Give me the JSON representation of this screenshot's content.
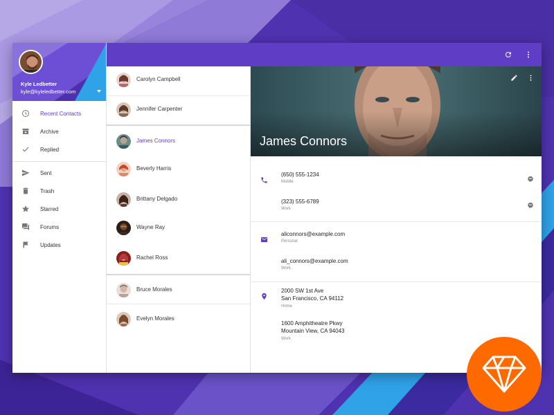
{
  "user": {
    "name": "Kyle Ledbetter",
    "email": "kyle@kyleledbetter.com"
  },
  "nav": {
    "items": [
      {
        "label": "Recent Contacts",
        "icon": "clock-icon",
        "active": true
      },
      {
        "label": "Archive",
        "icon": "archive-icon"
      },
      {
        "label": "Replied",
        "icon": "check-icon"
      },
      {
        "label": "Sent",
        "icon": "send-icon"
      },
      {
        "label": "Trash",
        "icon": "trash-icon"
      },
      {
        "label": "Starred",
        "icon": "star-icon"
      },
      {
        "label": "Forums",
        "icon": "forum-icon"
      },
      {
        "label": "Updates",
        "icon": "flag-icon"
      }
    ]
  },
  "toolbar": {
    "refresh_icon": "refresh-icon",
    "more_icon": "more-vert-icon"
  },
  "contacts": [
    {
      "name": "Carolyn Campbell",
      "avatar_color": "#c78f8a"
    },
    {
      "name": "Jennifer Carpenter",
      "avatar_color": "#8b6a55"
    },
    {
      "name": "James Connors",
      "avatar_color": "#6a8d8a",
      "active": true
    },
    {
      "name": "Beverly Harris",
      "avatar_color": "#d9896c"
    },
    {
      "name": "Brittany Delgado",
      "avatar_color": "#5b3b30"
    },
    {
      "name": "Wayne Ray",
      "avatar_color": "#3a2a24"
    },
    {
      "name": "Rachel Ross",
      "avatar_color": "#b23a3a"
    },
    {
      "name": "Bruce Morales",
      "avatar_color": "#b7a397"
    },
    {
      "name": "Evelyn Morales",
      "avatar_color": "#9c6b4e"
    }
  ],
  "detail": {
    "name": "James Connors",
    "phones": [
      {
        "value": "(650) 555-1234",
        "type": "Mobile"
      },
      {
        "value": "(323) 555-6789",
        "type": "Work"
      }
    ],
    "emails": [
      {
        "value": "aliconnors@example.com",
        "type": "Personal"
      },
      {
        "value": "ali_connors@example.com",
        "type": "Work"
      }
    ],
    "addresses": [
      {
        "line1": "2000 SW 1st Ave",
        "line2": "San Francisco, CA 94112",
        "type": "Home"
      },
      {
        "line1": "1600 Amphitheatre Pkwy",
        "line2": "Mountain View, CA 94043",
        "type": "Work"
      }
    ]
  },
  "colors": {
    "primary": "#5f3dc4",
    "accent_badge": "#ff6a00",
    "background": "#4a2fa8"
  }
}
